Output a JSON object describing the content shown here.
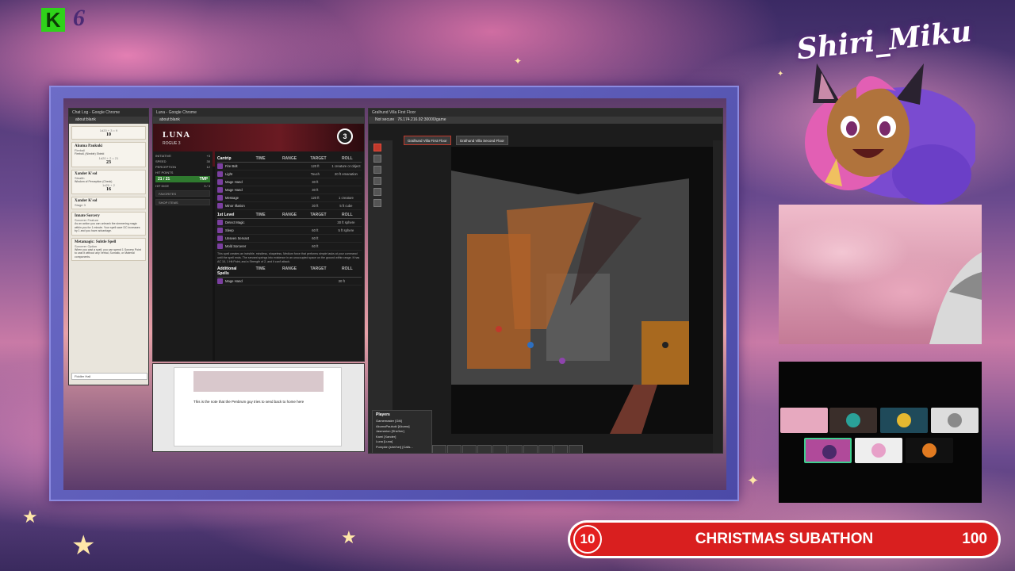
{
  "overlay": {
    "badge_letter": "K",
    "badge_number": "6",
    "streamer_name": "Shiri_Miku",
    "subathon": {
      "current": "10",
      "label": "CHRISTMAS SUBATHON",
      "goal": "100"
    }
  },
  "chat": {
    "title": "Chat Log - Google Chrome",
    "address": "about:blank",
    "cards": [
      {
        "roll": "10",
        "dice": "1d20 + 3 = 9"
      },
      {
        "name": "Akuma Paukuki",
        "sub": "Fireball",
        "text": "Fireball, (Nimble) Shield",
        "dice": "1d20 + 2 = 21",
        "roll": "23"
      },
      {
        "name": "Xander K'sol",
        "sub": "Stealth",
        "text": "Wisdom of Perception (Check)",
        "dice": "1d20 + 2",
        "roll": "16"
      },
      {
        "name": "Xander K'sol",
        "sub": "Stage 3"
      },
      {
        "name": "Innate Sorcery",
        "sub": "Sorcerer Feature",
        "text": "As an action you can unleash the simmering magic within you for 1 minute. Your spell save DC increases by 1 and you have advantage."
      },
      {
        "name": "Metamagic: Subtle Spell",
        "sub": "Sorcerer Option",
        "text": "When you cast a spell, you can spend 1 Sorcery Point to cast it without any Verbal, Somatic, or Material components."
      }
    ],
    "input_placeholder": "Fiddler Hall"
  },
  "sheet": {
    "title": "Luna - Google Chrome",
    "address": "about:blank",
    "name": "LUNA",
    "class_line": "ROGUE 3",
    "level": "3",
    "stats": [
      {
        "label": "INITIATIVE",
        "value": "+3"
      },
      {
        "label": "SPEED",
        "value": "30"
      },
      {
        "label": "PERCEPTION",
        "value": "12"
      }
    ],
    "hp_label": "HIT POINTS",
    "hp_value": "21 / 21",
    "hp_temp": "TMP",
    "hit_dice": "HIT DICE",
    "hit_dice_value": "3 / 3",
    "favorites": "FAVORITES",
    "shop_button": "SHOP ITEMS",
    "cantrip_header": "Cantrip",
    "cantrips": [
      {
        "name": "Fire Bolt",
        "range": "120 ft",
        "target": "1 creature or object"
      },
      {
        "name": "Light",
        "range": "Touch",
        "target": "20 ft emanation"
      },
      {
        "name": "Mage Hand",
        "range": "30 ft",
        "target": ""
      },
      {
        "name": "Mage Hand",
        "range": "30 ft",
        "target": ""
      },
      {
        "name": "Message",
        "range": "120 ft",
        "target": "1 creature"
      },
      {
        "name": "Minor Illusion",
        "range": "30 ft",
        "target": "5 ft cube"
      }
    ],
    "level1_header": "1st Level",
    "level1": [
      {
        "name": "Detect Magic",
        "range": "",
        "target": "30 ft sphere"
      },
      {
        "name": "Sleep",
        "range": "60 ft",
        "target": "5 ft sphere"
      },
      {
        "name": "Unseen Servant",
        "range": "60 ft",
        "target": ""
      },
      {
        "name": "Mold Sorcerer",
        "range": "60 ft",
        "target": ""
      }
    ],
    "col_time": "TIME",
    "col_range": "RANGE",
    "col_target": "TARGET",
    "col_roll": "ROLL",
    "description": "This spell creates an invisible, mindless, shapeless, Medium force that performs simple tasks at your command until the spell ends. The servant springs into existence in an unoccupied space on the ground within range. It has AC 10, 1 Hit Point, and a Strength of 2, and it can't attack.",
    "additional_header": "Additional Spells",
    "additional": [
      {
        "name": "Mage Hand",
        "range": "30 ft"
      }
    ]
  },
  "doc": {
    "text": "This is the note that the Penbrum guy tries to send back to home here"
  },
  "vtt": {
    "title": "Gralhund Villa First Floor",
    "address": "76.174.216.92:30000/game",
    "security": "Not secure",
    "tab_first": "Gralhund Villa First Floor",
    "tab_second": "Gralhund Villa Second Floor",
    "players_title": "Players",
    "players": [
      "Gamemaster [GM]",
      "AkumaPaukuki [Akuma]",
      "Jasmarion [She/her]",
      "Kami [Xander]",
      "Luna [Luna]",
      "Pumpkin [she/her] [Calis..."
    ],
    "hotbar": [
      "1",
      "2",
      "3",
      "4",
      "5",
      "6",
      "7",
      "8",
      "9",
      "0"
    ]
  },
  "colors": {
    "subathon_red": "#d91f1f",
    "frame_blue": "#5b5ab8",
    "sheet_accent": "#6a1a22",
    "vtt_accent": "#c0392b"
  }
}
